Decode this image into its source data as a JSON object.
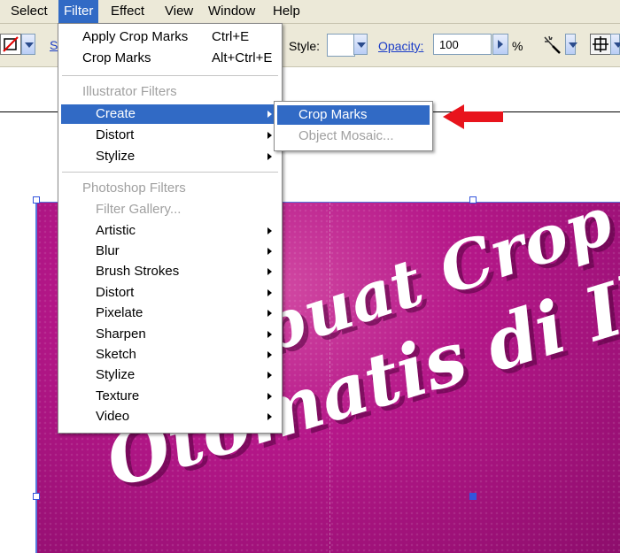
{
  "menubar": {
    "items": [
      {
        "label": "Select"
      },
      {
        "label": "Filter"
      },
      {
        "label": "Effect"
      },
      {
        "label": "View"
      },
      {
        "label": "Window"
      },
      {
        "label": "Help"
      }
    ]
  },
  "toolbar": {
    "style_label": "Style:",
    "opacity_label": "Opacity:",
    "opacity_value": "100",
    "percent": "%",
    "s_label": "S"
  },
  "filter_menu": {
    "apply_crop_marks": {
      "label": "Apply Crop Marks",
      "shortcut": "Ctrl+E"
    },
    "crop_marks": {
      "label": "Crop Marks",
      "shortcut": "Alt+Ctrl+E"
    },
    "illustrator_header": "Illustrator Filters",
    "illustrator_items": [
      {
        "label": "Create"
      },
      {
        "label": "Distort"
      },
      {
        "label": "Stylize"
      }
    ],
    "photoshop_header": "Photoshop Filters",
    "filter_gallery": "Filter Gallery...",
    "photoshop_items": [
      {
        "label": "Artistic"
      },
      {
        "label": "Blur"
      },
      {
        "label": "Brush Strokes"
      },
      {
        "label": "Distort"
      },
      {
        "label": "Pixelate"
      },
      {
        "label": "Sharpen"
      },
      {
        "label": "Sketch"
      },
      {
        "label": "Stylize"
      },
      {
        "label": "Texture"
      },
      {
        "label": "Video"
      }
    ]
  },
  "create_submenu": {
    "items": [
      {
        "label": "Crop Marks"
      },
      {
        "label": "Object Mosaic..."
      }
    ]
  },
  "artwork": {
    "line1": "Membuat Crop M",
    "line2": "Otomatis di Ill"
  },
  "colors": {
    "highlight": "#316ac5",
    "artwork_bg": "#b51789",
    "arrow": "#e8141c"
  },
  "icons": [
    "none-stroke-swatch-icon",
    "dropdown-chevron-icon",
    "recolor-wand-icon",
    "align-icon",
    "red-pointer-arrow-icon"
  ]
}
